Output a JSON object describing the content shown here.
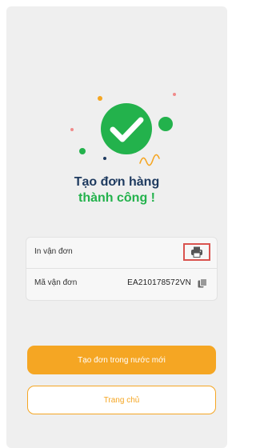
{
  "success": {
    "title_line1": "Tạo đơn hàng",
    "title_line2": "thành công !",
    "icon": "check-circle-icon"
  },
  "details": {
    "print_label": "In vận đơn",
    "print_icon": "printer-icon",
    "code_label": "Mã vận đơn",
    "code_value": "EA210178572VN",
    "copy_icon": "copy-icon"
  },
  "actions": {
    "new_order_label": "Tạo đơn trong nước mới",
    "home_label": "Trang chủ"
  },
  "colors": {
    "accent_green": "#23b24c",
    "brand_orange": "#f5a623",
    "title_navy": "#1e3a5f",
    "highlight_red": "#d9534f"
  }
}
